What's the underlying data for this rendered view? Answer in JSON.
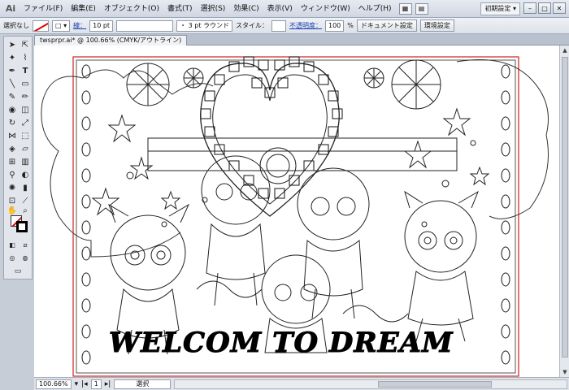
{
  "app": {
    "logo": "Ai",
    "menu": [
      "ファイル(F)",
      "編集(E)",
      "オブジェクト(O)",
      "書式(T)",
      "選択(S)",
      "効果(C)",
      "表示(V)",
      "ウィンドウ(W)",
      "ヘルプ(H)"
    ],
    "workspace": "初期設定 ▾"
  },
  "control": {
    "selection": "選択なし",
    "stroke_label": "線：",
    "stroke_weight": "10 pt",
    "brush": "・ 3 pt ラウンド",
    "style_label": "スタイル：",
    "opacity_label": "不透明度：",
    "opacity_value": "100",
    "percent": "%",
    "doc_settings": "ドキュメント設定",
    "preferences": "環境設定"
  },
  "document": {
    "tab": "twsprpr.ai* @ 100.66% (CMYK/アウトライン)",
    "artwork_text": "WELCOM TO DREAM"
  },
  "status": {
    "zoom": "100.66%",
    "page": "1",
    "tool": "選択"
  }
}
